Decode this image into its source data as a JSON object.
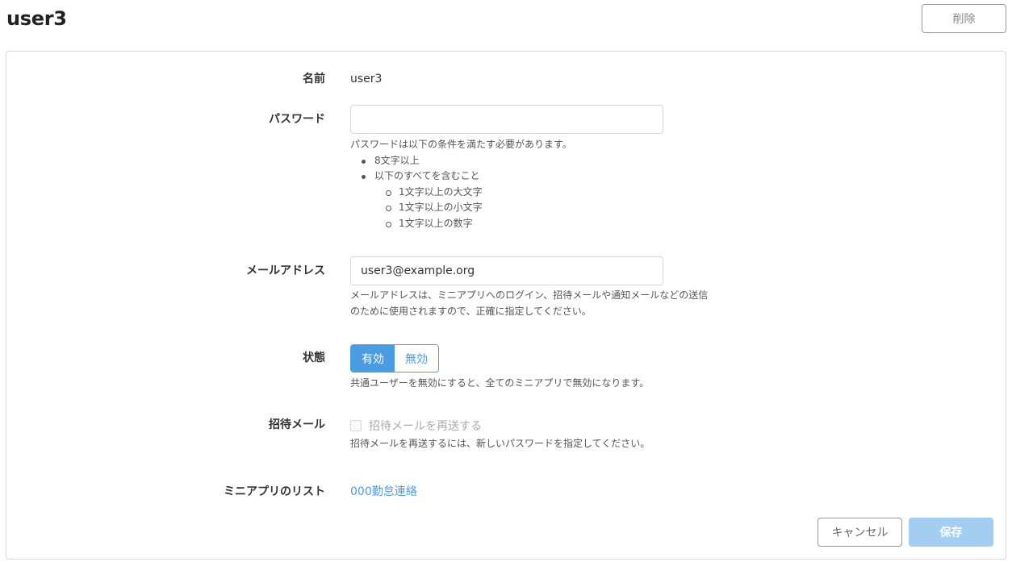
{
  "header": {
    "title": "user3",
    "delete_label": "削除"
  },
  "form": {
    "name": {
      "label": "名前",
      "value": "user3"
    },
    "password": {
      "label": "パスワード",
      "value": "",
      "help_intro": "パスワードは以下の条件を満たす必要があります。",
      "rules": [
        "8文字以上",
        "以下のすべてを含むこと"
      ],
      "sub_rules": [
        "1文字以上の大文字",
        "1文字以上の小文字",
        "1文字以上の数字"
      ]
    },
    "email": {
      "label": "メールアドレス",
      "value": "user3@example.org",
      "help_line1": "メールアドレスは、ミニアプリへのログイン、招待メールや通知メールなどの送信",
      "help_line2": "のために使用されますので、正確に指定してください。"
    },
    "status": {
      "label": "状態",
      "options": [
        "有効",
        "無効"
      ],
      "selected": "有効",
      "help": "共通ユーザーを無効にすると、全てのミニアプリで無効になります。"
    },
    "invite": {
      "label": "招待メール",
      "checkbox_label": "招待メールを再送する",
      "checked": false,
      "help": "招待メールを再送するには、新しいパスワードを指定してください。"
    },
    "miniapps": {
      "label": "ミニアプリのリスト",
      "items": [
        "000勤怠連絡"
      ]
    }
  },
  "footer": {
    "cancel_label": "キャンセル",
    "save_label": "保存"
  },
  "colors": {
    "accent": "#4a9de0",
    "save_disabled": "#a3cdf1",
    "border": "#d9d9d9"
  }
}
